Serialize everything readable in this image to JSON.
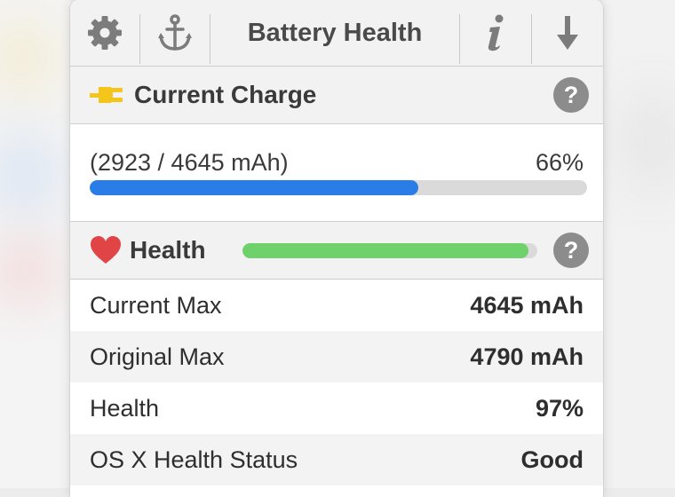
{
  "toolbar": {
    "title": "Battery Health",
    "icons": [
      "gear-icon",
      "anchor-icon",
      "info-icon",
      "download-icon"
    ]
  },
  "current_charge": {
    "title": "Current Charge",
    "icon": "plug-icon",
    "mah_text": "(2923 / 4645 mAh)",
    "percent_text": "66%",
    "level": 0.66,
    "bar_color": "#2a7de6"
  },
  "health": {
    "title": "Health",
    "icon": "heart-icon",
    "level": 0.97,
    "bar_color": "#6ed16b"
  },
  "help_label": "?",
  "rows": [
    {
      "label": "Current Max",
      "value": "4645 mAh"
    },
    {
      "label": "Original Max",
      "value": "4790 mAh"
    },
    {
      "label": "Health",
      "value": "97%"
    },
    {
      "label": "OS X Health Status",
      "value": "Good"
    }
  ]
}
